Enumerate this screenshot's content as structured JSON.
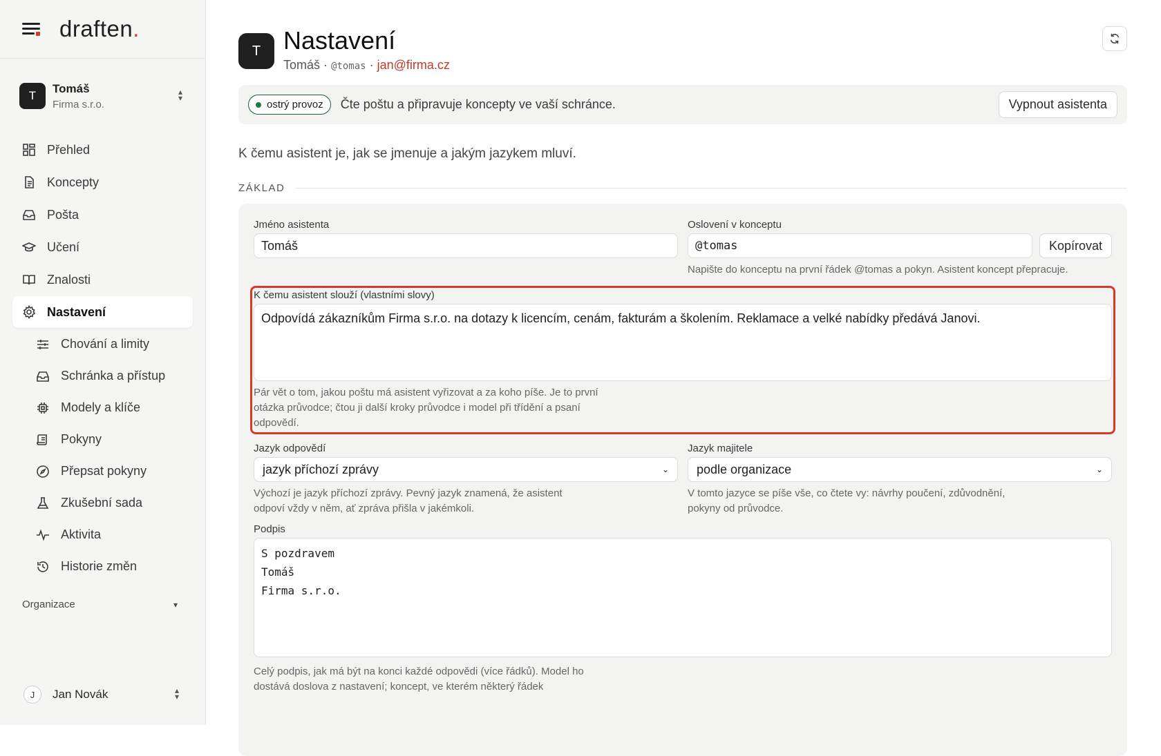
{
  "brand": {
    "logo_text": "draften",
    "logo_dot": "."
  },
  "account": {
    "initial": "T",
    "name": "Tomáš",
    "org": "Firma s.r.o."
  },
  "nav": {
    "items": [
      {
        "label": "Přehled",
        "icon": "dashboard-icon"
      },
      {
        "label": "Koncepty",
        "icon": "document-icon"
      },
      {
        "label": "Pošta",
        "icon": "inbox-icon"
      },
      {
        "label": "Učení",
        "icon": "graduation-cap-icon"
      },
      {
        "label": "Znalosti",
        "icon": "book-icon"
      },
      {
        "label": "Nastavení",
        "icon": "gear-icon",
        "active": true
      }
    ],
    "subitems": [
      {
        "label": "Chování a limity",
        "icon": "sliders-icon"
      },
      {
        "label": "Schránka a přístup",
        "icon": "inbox-icon"
      },
      {
        "label": "Modely a klíče",
        "icon": "chip-icon"
      },
      {
        "label": "Pokyny",
        "icon": "scroll-icon"
      },
      {
        "label": "Přepsat pokyny",
        "icon": "compass-icon"
      },
      {
        "label": "Zkušební sada",
        "icon": "flask-icon"
      },
      {
        "label": "Aktivita",
        "icon": "activity-icon"
      },
      {
        "label": "Historie změn",
        "icon": "history-icon"
      }
    ],
    "org_label": "Organizace"
  },
  "user": {
    "initial": "J",
    "name": "Jan Novák"
  },
  "header": {
    "avatar_initial": "T",
    "title": "Nastavení",
    "name": "Tomáš",
    "separator": " · ",
    "handle": "@tomas",
    "email": "jan@firma.cz"
  },
  "status": {
    "badge": "ostrý provoz",
    "text": "Čte poštu a připravuje koncepty ve vaší schránce.",
    "button": "Vypnout asistenta",
    "badge_color": "#1f7a4a"
  },
  "intro": "K čemu asistent je, jak se jmenuje a jakým jazykem mluví.",
  "section": {
    "label": "ZÁKLAD"
  },
  "form": {
    "name_label": "Jméno asistenta",
    "name_value": "Tomáš",
    "address_label": "Oslovení v konceptu",
    "address_value": "@tomas",
    "copy_button": "Kopírovat",
    "address_help": "Napište do konceptu na první řádek @tomas a pokyn. Asistent koncept přepracuje.",
    "purpose_label": "K čemu asistent slouží (vlastními slovy)",
    "purpose_value": "Odpovídá zákazníkům Firma s.r.o. na dotazy k licencím, cenám, fakturám a školením. Reklamace a velké nabídky předává Janovi.",
    "purpose_help": "Pár vět o tom, jakou poštu má asistent vyřizovat a za koho píše. Je to první otázka průvodce; čtou ji další kroky průvodce i model při třídění a psaní odpovědí.",
    "reply_lang_label": "Jazyk odpovědí",
    "reply_lang_value": "jazyk příchozí zprávy",
    "reply_lang_help": "Výchozí je jazyk příchozí zprávy. Pevný jazyk znamená, že asistent odpoví vždy v něm, ať zpráva přišla v jakémkoli.",
    "owner_lang_label": "Jazyk majitele",
    "owner_lang_value": "podle organizace",
    "owner_lang_help": "V tomto jazyce se píše vše, co čtete vy: návrhy poučení, zdůvodnění, pokyny od průvodce.",
    "signature_label": "Podpis",
    "signature_value": "S pozdravem\nTomáš\nFirma s.r.o.",
    "signature_help": "Celý podpis, jak má být na konci každé odpovědi (více řádků). Model ho dostává doslova z nastavení; koncept, ve kterém některý řádek"
  },
  "colors": {
    "accent": "#d63a2a",
    "sidebar_bg": "#f5f5f4",
    "card_bg": "#f3f3f2"
  }
}
